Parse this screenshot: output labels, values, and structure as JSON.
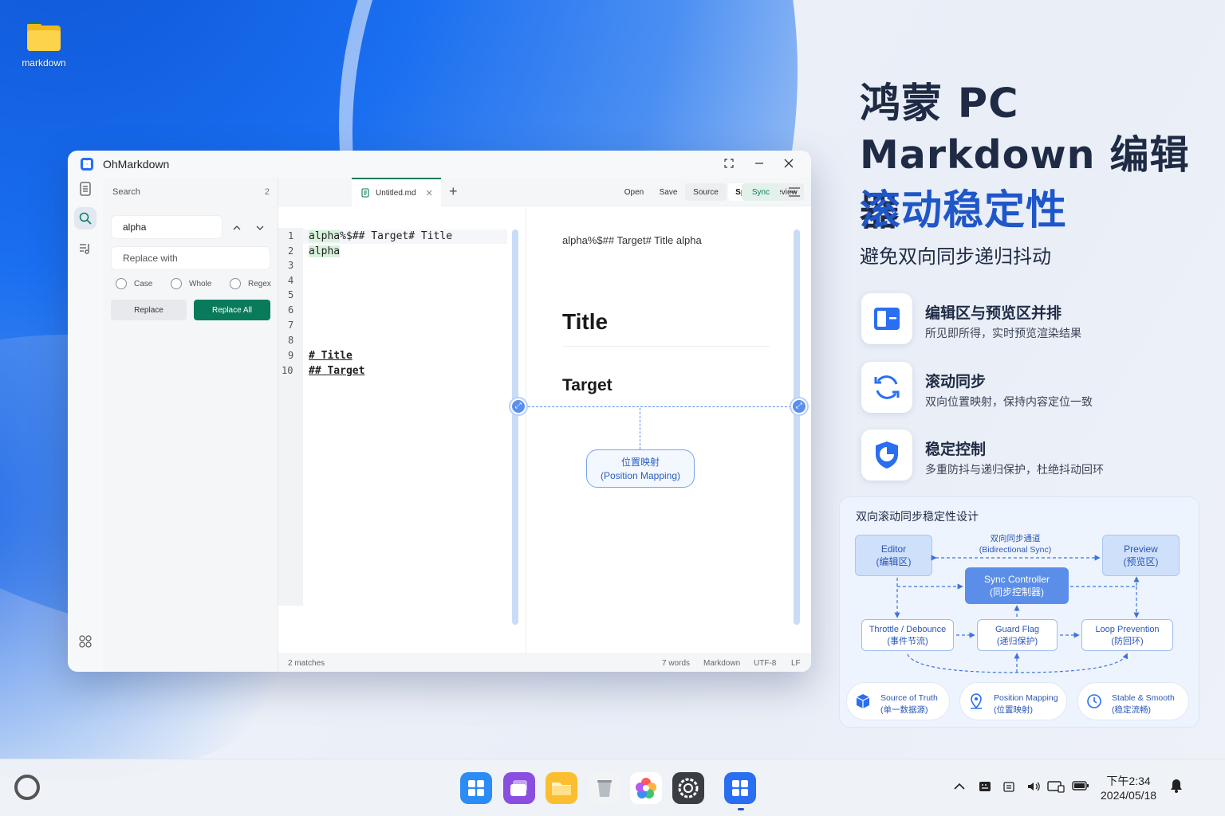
{
  "desktop": {
    "folder_label": "markdown"
  },
  "app": {
    "title": "OhMarkdown",
    "search": {
      "heading": "Search",
      "count": "2",
      "query": "alpha",
      "replace_placeholder": "Replace with",
      "options": [
        "Case",
        "Whole",
        "Regex"
      ],
      "replace_label": "Replace",
      "replace_all_label": "Replace All"
    },
    "tab": {
      "name": "Untitled.md"
    },
    "toolbar": [
      "Open",
      "Save",
      "Source",
      "Split",
      "Preview",
      "Sync"
    ],
    "active_mode": "Split",
    "editor": {
      "line_numbers": [
        "1",
        "2",
        "3",
        "4",
        "5",
        "6",
        "7",
        "8",
        "9",
        "10"
      ],
      "line1": "alpha%$## Target# Title",
      "line2": "alpha",
      "line9": "# Title",
      "line10": "## Target"
    },
    "preview": {
      "line": "alpha%$## Target# Title alpha",
      "h1": "Title",
      "h2": "Target"
    },
    "mapping": {
      "label_cn": "位置映射",
      "label_en": "(Position Mapping)"
    },
    "status": {
      "matches": "2 matches",
      "words": "7 words",
      "lang": "Markdown",
      "encoding": "UTF-8",
      "eol": "LF"
    }
  },
  "promo": {
    "title_line1": "鸿蒙 PC",
    "title_line2": "Markdown 编辑器",
    "title_line3": "滚动稳定性",
    "subtitle": "避免双向同步递归抖动",
    "features": [
      {
        "title": "编辑区与预览区并排",
        "desc": "所见即所得，实时预览渲染结果",
        "icon": "split-view-icon"
      },
      {
        "title": "滚动同步",
        "desc": "双向位置映射，保持内容定位一致",
        "icon": "sync-icon"
      },
      {
        "title": "稳定控制",
        "desc": "多重防抖与递归保护，杜绝抖动回环",
        "icon": "shield-icon"
      }
    ],
    "diagram": {
      "title": "双向滚动同步稳定性设计",
      "editor": [
        "Editor",
        "(编辑区)"
      ],
      "preview": [
        "Preview",
        "(预览区)"
      ],
      "channel": [
        "双向同步通道",
        "(Bidirectional Sync)"
      ],
      "controller": [
        "Sync Controller",
        "(同步控制器)"
      ],
      "throttle": [
        "Throttle / Debounce",
        "(事件节流)"
      ],
      "guard": [
        "Guard Flag",
        "(递归保护)"
      ],
      "loop": [
        "Loop Prevention",
        "(防回环)"
      ],
      "pills": [
        [
          "Source of Truth",
          "(单一数据源)"
        ],
        [
          "Position Mapping",
          "(位置映射)"
        ],
        [
          "Stable & Smooth",
          "(稳定流畅)"
        ]
      ]
    }
  },
  "taskbar": {
    "apps": [
      "launcher-app",
      "multitask-app",
      "files-app",
      "trash-app",
      "gallery-app",
      "settings-app",
      "ohmarkdown-app"
    ],
    "time": "下午2:34",
    "date": "2024/05/18"
  },
  "colors": {
    "accent_green": "#0a7a5c",
    "accent_blue": "#1f56c8",
    "sync_line": "#5a8ff0"
  }
}
